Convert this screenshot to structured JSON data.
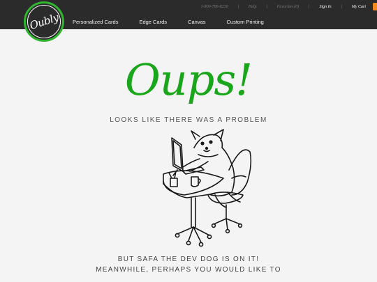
{
  "header": {
    "logo_text": "Oubly",
    "nav": [
      "Personalized Cards",
      "Edge Cards",
      "Canvas",
      "Custom Printing"
    ],
    "phone": "1-800-796-8230",
    "help": "Help",
    "favorites": "Favorites (0)",
    "sign_in": "Sign In",
    "cart": "My Cart",
    "colors": {
      "bar": "#2b2b2b",
      "accent": "#2fb52f",
      "cart": "#f28a1e"
    }
  },
  "main": {
    "headline": "Oups!",
    "problem": "LOOKS LIKE THERE WAS A PROBLEM",
    "line1": "BUT SAFA THE DEV DOG IS ON IT!",
    "line2": "MEANWHILE, PERHAPS YOU WOULD LIKE TO",
    "headline_color": "#1aa61a",
    "illustration": "dog-at-computer-illustration"
  }
}
